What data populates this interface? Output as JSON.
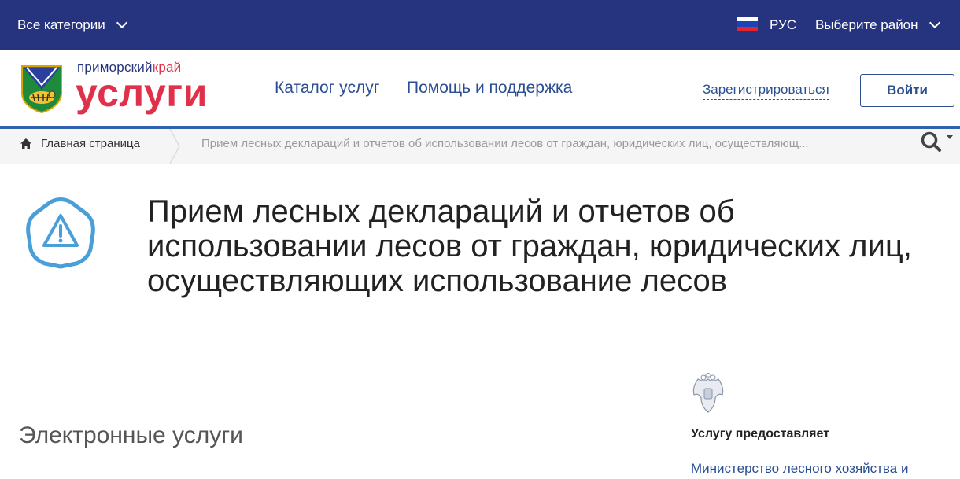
{
  "topbar": {
    "categories_label": "Все категории",
    "language": "РУС",
    "district_label": "Выберите район"
  },
  "header": {
    "logo_region": "приморский",
    "logo_krai": "край",
    "logo_title": "услуги",
    "nav": [
      "Каталог услуг",
      "Помощь и поддержка"
    ],
    "register_label": "Зарегистрироваться",
    "login_label": "Войти"
  },
  "breadcrumb": {
    "home": "Главная страница",
    "current": "Прием лесных деклараций и отчетов об использовании лесов от граждан, юридических лиц, осуществляющ..."
  },
  "page": {
    "title": "Прием лесных деклараций и отчетов об использовании лесов от граждан, юридических лиц, осуществляющих использование лесов",
    "section_heading": "Электронные услуги"
  },
  "provider": {
    "label": "Услугу предоставляет",
    "name": "Министерство лесного хозяйства и"
  },
  "colors": {
    "topbar": "#26347f",
    "accent_red": "#e0304a",
    "link_blue": "#2b4f93",
    "icon_blue": "#4a9fd8"
  }
}
